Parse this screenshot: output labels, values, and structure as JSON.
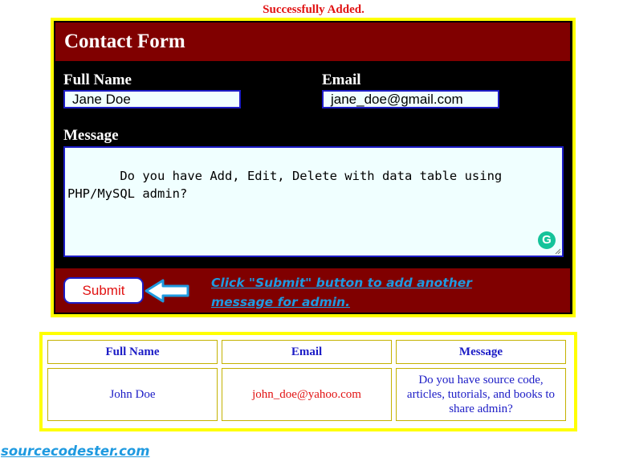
{
  "status_message": "Successfully Added.",
  "form": {
    "title": "Contact Form",
    "full_name_label": "Full Name",
    "full_name_value": "Jane Doe",
    "email_label": "Email",
    "email_value": "jane_doe@gmail.com",
    "message_label": "Message",
    "message_value": " Do you have Add, Edit, Delete with data table using PHP/MySQL admin?",
    "grammarly_icon": "grammarly-icon",
    "submit_label": "Submit",
    "hint_line1": "Click \"Submit\" button to add another",
    "hint_line2": "message for admin."
  },
  "table": {
    "headers": [
      "Full Name",
      "Email",
      "Message"
    ],
    "rows": [
      {
        "full_name": "John Doe",
        "email": "john_doe@yahoo.com",
        "message": "Do you have source code, articles, tutorials, and books to share admin?"
      }
    ]
  },
  "footer_text": "sourcecodester.com",
  "colors": {
    "form_header": "#800000",
    "border_yellow": "#ffff00",
    "link_blue": "#1f9ae0",
    "status_red": "#e11212",
    "text_blue": "#1c1cc6"
  }
}
